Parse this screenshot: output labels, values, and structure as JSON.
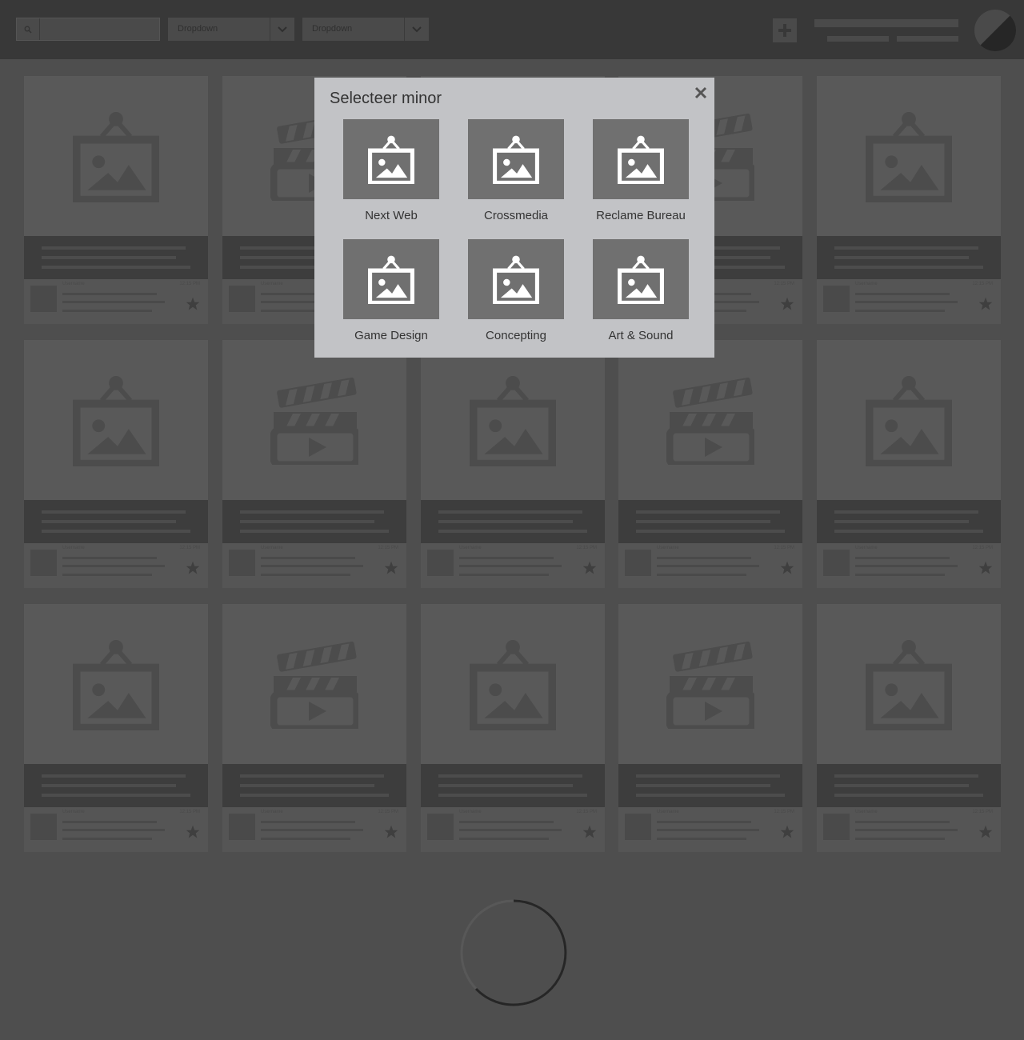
{
  "topbar": {
    "search": {
      "placeholder": ""
    },
    "dropdowns": [
      {
        "label": "Dropdown"
      },
      {
        "label": "Dropdown"
      }
    ],
    "icons": {
      "search": "search-icon",
      "caret": "chevron-down-icon",
      "add": "plus-icon",
      "avatar": "avatar"
    }
  },
  "grid": {
    "columns": 5,
    "rows": 3,
    "card_types": [
      [
        "image",
        "video",
        "image",
        "video",
        "image"
      ],
      [
        "image",
        "video",
        "image",
        "video",
        "image"
      ],
      [
        "image",
        "video",
        "image",
        "video",
        "image"
      ]
    ],
    "card_footer": {
      "username": "Username",
      "time": "12:15 PM"
    }
  },
  "modal": {
    "title": "Selecteer minor",
    "close_icon": "close-icon",
    "options": [
      {
        "label": "Next Web"
      },
      {
        "label": "Crossmedia"
      },
      {
        "label": "Reclame Bureau"
      },
      {
        "label": "Game Design"
      },
      {
        "label": "Concepting"
      },
      {
        "label": "Art & Sound"
      }
    ]
  },
  "loader": {
    "icon": "loading-spinner"
  },
  "colors": {
    "overlay_background": "#4e4e4e",
    "topbar": "#383838",
    "modal": "#c2c3c6",
    "tile": "#707070",
    "text": "#333333"
  }
}
